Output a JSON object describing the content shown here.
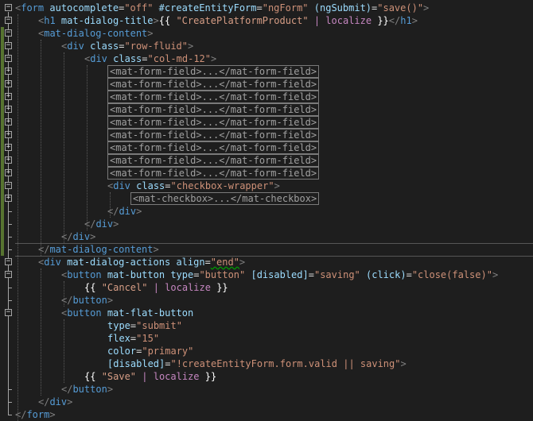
{
  "lines": [
    {
      "parts": [
        {
          "c": "br",
          "t": "<"
        },
        {
          "c": "tag",
          "t": "form"
        },
        {
          "c": "txt",
          "t": " "
        },
        {
          "c": "attr",
          "t": "autocomplete"
        },
        {
          "c": "txt",
          "t": "="
        },
        {
          "c": "val",
          "t": "\"off\""
        },
        {
          "c": "txt",
          "t": " "
        },
        {
          "c": "attr",
          "t": "#createEntityForm"
        },
        {
          "c": "txt",
          "t": "="
        },
        {
          "c": "val",
          "t": "\"ngForm\""
        },
        {
          "c": "txt",
          "t": " "
        },
        {
          "c": "attr",
          "t": "(ngSubmit)"
        },
        {
          "c": "txt",
          "t": "="
        },
        {
          "c": "val",
          "t": "\"save()\""
        },
        {
          "c": "br",
          "t": ">"
        }
      ]
    },
    {
      "parts": [
        {
          "c": "br",
          "t": "<"
        },
        {
          "c": "tag",
          "t": "h1"
        },
        {
          "c": "txt",
          "t": " "
        },
        {
          "c": "attr",
          "t": "mat-dialog-title"
        },
        {
          "c": "br",
          "t": ">"
        },
        {
          "c": "mustache",
          "t": "{{ "
        },
        {
          "c": "str",
          "t": "\"CreatePlatformProduct\""
        },
        {
          "c": "txt",
          "t": " "
        },
        {
          "c": "pipe",
          "t": "| localize"
        },
        {
          "c": "mustache",
          "t": " }}"
        },
        {
          "c": "br",
          "t": "</"
        },
        {
          "c": "tag",
          "t": "h1"
        },
        {
          "c": "br",
          "t": ">"
        }
      ]
    },
    {
      "parts": [
        {
          "c": "br",
          "t": "<"
        },
        {
          "c": "tag",
          "t": "mat-dialog-content"
        },
        {
          "c": "br",
          "t": ">"
        }
      ]
    },
    {
      "parts": [
        {
          "c": "br",
          "t": "<"
        },
        {
          "c": "tag",
          "t": "div"
        },
        {
          "c": "txt",
          "t": " "
        },
        {
          "c": "attr",
          "t": "class"
        },
        {
          "c": "txt",
          "t": "="
        },
        {
          "c": "val",
          "t": "\"row-fluid\""
        },
        {
          "c": "br",
          "t": ">"
        }
      ]
    },
    {
      "parts": [
        {
          "c": "br",
          "t": "<"
        },
        {
          "c": "tag",
          "t": "div"
        },
        {
          "c": "txt",
          "t": " "
        },
        {
          "c": "attr",
          "t": "class"
        },
        {
          "c": "txt",
          "t": "="
        },
        {
          "c": "val",
          "t": "\"col-md-12\""
        },
        {
          "c": "br",
          "t": ">"
        }
      ]
    },
    {
      "boxed": "<mat-form-field>...</mat-form-field>"
    },
    {
      "boxed": "<mat-form-field>...</mat-form-field>"
    },
    {
      "boxed": "<mat-form-field>...</mat-form-field>"
    },
    {
      "boxed": "<mat-form-field>...</mat-form-field>"
    },
    {
      "boxed": "<mat-form-field>...</mat-form-field>"
    },
    {
      "boxed": "<mat-form-field>...</mat-form-field>"
    },
    {
      "boxed": "<mat-form-field>...</mat-form-field>"
    },
    {
      "boxed": "<mat-form-field>...</mat-form-field>"
    },
    {
      "boxed": "<mat-form-field>...</mat-form-field>"
    },
    {
      "parts": [
        {
          "c": "br",
          "t": "<"
        },
        {
          "c": "tag",
          "t": "div"
        },
        {
          "c": "txt",
          "t": " "
        },
        {
          "c": "attr",
          "t": "class"
        },
        {
          "c": "txt",
          "t": "="
        },
        {
          "c": "val",
          "t": "\"checkbox-wrapper\""
        },
        {
          "c": "br",
          "t": ">"
        }
      ]
    },
    {
      "boxed": "<mat-checkbox>...</mat-checkbox>"
    },
    {
      "parts": [
        {
          "c": "br",
          "t": "</"
        },
        {
          "c": "tag",
          "t": "div"
        },
        {
          "c": "br",
          "t": ">"
        }
      ]
    },
    {
      "parts": [
        {
          "c": "br",
          "t": "</"
        },
        {
          "c": "tag",
          "t": "div"
        },
        {
          "c": "br",
          "t": ">"
        }
      ]
    },
    {
      "parts": [
        {
          "c": "br",
          "t": "</"
        },
        {
          "c": "tag",
          "t": "div"
        },
        {
          "c": "br",
          "t": ">"
        }
      ]
    },
    {
      "parts": [
        {
          "c": "br",
          "t": "</"
        },
        {
          "c": "tag",
          "t": "mat-dialog-content"
        },
        {
          "c": "br",
          "t": ">"
        }
      ]
    },
    {
      "parts": [
        {
          "c": "br",
          "t": "<"
        },
        {
          "c": "tag",
          "t": "div"
        },
        {
          "c": "txt",
          "t": " "
        },
        {
          "c": "attr",
          "t": "mat-dialog-actions"
        },
        {
          "c": "txt",
          "t": " "
        },
        {
          "c": "attr",
          "t": "align"
        },
        {
          "c": "txt",
          "t": "="
        },
        {
          "c": "val",
          "t": "\"end\""
        },
        {
          "c": "br",
          "t": ">"
        }
      ]
    },
    {
      "parts": [
        {
          "c": "br",
          "t": "<"
        },
        {
          "c": "tag",
          "t": "button"
        },
        {
          "c": "txt",
          "t": " "
        },
        {
          "c": "attr",
          "t": "mat-button"
        },
        {
          "c": "txt",
          "t": " "
        },
        {
          "c": "attr",
          "t": "type"
        },
        {
          "c": "txt",
          "t": "="
        },
        {
          "c": "val",
          "t": "\"button\""
        },
        {
          "c": "txt",
          "t": " "
        },
        {
          "c": "attr",
          "t": "[disabled]"
        },
        {
          "c": "txt",
          "t": "="
        },
        {
          "c": "val",
          "t": "\"saving\""
        },
        {
          "c": "txt",
          "t": " "
        },
        {
          "c": "attr",
          "t": "(click)"
        },
        {
          "c": "txt",
          "t": "="
        },
        {
          "c": "val",
          "t": "\"close(false)\""
        },
        {
          "c": "br",
          "t": ">"
        }
      ]
    },
    {
      "parts": [
        {
          "c": "mustache",
          "t": "{{ "
        },
        {
          "c": "str",
          "t": "\"Cancel\""
        },
        {
          "c": "txt",
          "t": " "
        },
        {
          "c": "pipe",
          "t": "| localize"
        },
        {
          "c": "mustache",
          "t": " }}"
        }
      ]
    },
    {
      "parts": [
        {
          "c": "br",
          "t": "</"
        },
        {
          "c": "tag",
          "t": "button"
        },
        {
          "c": "br",
          "t": ">"
        }
      ]
    },
    {
      "parts": [
        {
          "c": "br",
          "t": "<"
        },
        {
          "c": "tag",
          "t": "button"
        },
        {
          "c": "txt",
          "t": " "
        },
        {
          "c": "attr",
          "t": "mat-flat-button"
        }
      ]
    },
    {
      "parts": [
        {
          "c": "attr",
          "t": "type"
        },
        {
          "c": "txt",
          "t": "="
        },
        {
          "c": "val",
          "t": "\"submit\""
        }
      ]
    },
    {
      "parts": [
        {
          "c": "attr",
          "t": "flex"
        },
        {
          "c": "txt",
          "t": "="
        },
        {
          "c": "val",
          "t": "\"15\""
        }
      ]
    },
    {
      "parts": [
        {
          "c": "attr",
          "t": "color"
        },
        {
          "c": "txt",
          "t": "="
        },
        {
          "c": "val",
          "t": "\"primary\""
        }
      ]
    },
    {
      "parts": [
        {
          "c": "attr",
          "t": "[disabled]"
        },
        {
          "c": "txt",
          "t": "="
        },
        {
          "c": "val",
          "t": "\"!createEntityForm.form.valid || saving\""
        },
        {
          "c": "br",
          "t": ">"
        }
      ]
    },
    {
      "parts": [
        {
          "c": "mustache",
          "t": "{{ "
        },
        {
          "c": "str",
          "t": "\"Save\""
        },
        {
          "c": "txt",
          "t": " "
        },
        {
          "c": "pipe",
          "t": "| localize"
        },
        {
          "c": "mustache",
          "t": " }}"
        }
      ]
    },
    {
      "parts": [
        {
          "c": "br",
          "t": "</"
        },
        {
          "c": "tag",
          "t": "button"
        },
        {
          "c": "br",
          "t": ">"
        }
      ]
    },
    {
      "parts": [
        {
          "c": "br",
          "t": "</"
        },
        {
          "c": "tag",
          "t": "div"
        },
        {
          "c": "br",
          "t": ">"
        }
      ]
    },
    {
      "parts": [
        {
          "c": "br",
          "t": "</"
        },
        {
          "c": "tag",
          "t": "form"
        },
        {
          "c": "br",
          "t": ">"
        }
      ]
    }
  ],
  "colors": {
    "background": "#1e1e1e",
    "tag": "#569cd6",
    "attribute": "#9cdcfe",
    "value": "#ce9178",
    "string": "#d69d85",
    "pipe": "#c586c0",
    "changebar": "#577430"
  }
}
